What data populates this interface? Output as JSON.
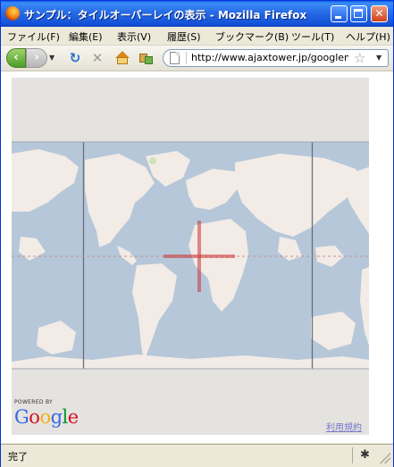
{
  "window": {
    "title": "サンプル：タイルオーバーレイの表示 - Mozilla Firefox"
  },
  "menu": {
    "items": [
      "ファイル(F)",
      "編集(E)",
      "表示(V)",
      "履歴(S)",
      "ブックマーク(B)",
      "ツール(T)",
      "ヘルプ(H)"
    ]
  },
  "navigation": {
    "url": "http://www.ajaxtower.jp/googlemaps/"
  },
  "map": {
    "powered_by": "POWERED BY",
    "logo": "Google",
    "terms": "利用規約",
    "overlay_color": "#cc3333"
  },
  "status": {
    "text": "完了"
  },
  "colors": {
    "ocean": "#b5c7d9",
    "land": "#f2ebe6",
    "map_background": "#e5e3df",
    "titlebar": "#1352d8"
  }
}
